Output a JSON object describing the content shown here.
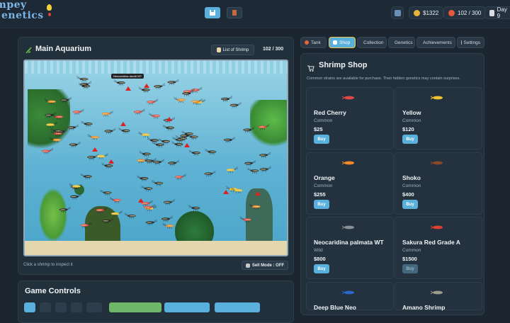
{
  "app": {
    "logo_line1": "mpey",
    "logo_line2": "enetics"
  },
  "stats": {
    "money": "$1322",
    "shrimp_count": "102 / 300",
    "day": "Day 9"
  },
  "aquarium": {
    "title": "Main Aquarium",
    "list_button": "List of Shrimp",
    "count": "102 / 300",
    "hint": "Click a shrimp to inspect it",
    "sell_mode": "Sell Mode : OFF",
    "tooltip": "Neocaridina davidi WT"
  },
  "tabs": [
    {
      "label": "Tank",
      "icon": "fish-icon"
    },
    {
      "label": "Shop",
      "icon": "cart-icon"
    },
    {
      "label": "Collection",
      "icon": "book-icon"
    },
    {
      "label": "Genetics",
      "icon": "dna-icon"
    },
    {
      "label": "Achievements",
      "icon": "trophy-icon"
    },
    {
      "label": "Settings",
      "icon": "gear-icon"
    }
  ],
  "shop": {
    "title": "Shrimp Shop",
    "subtitle": "Common strains are available for purchase. Their hidden genetics may contain surprises.",
    "buy_label": "Buy",
    "items": [
      {
        "name": "Red Cherry",
        "rarity": "Common",
        "price": "$25",
        "color": "#e04848"
      },
      {
        "name": "Yellow",
        "rarity": "Common",
        "price": "$120",
        "color": "#f1c232"
      },
      {
        "name": "Orange",
        "rarity": "Common",
        "price": "$255",
        "color": "#f08a2a"
      },
      {
        "name": "Shoko",
        "rarity": "Common",
        "price": "$400",
        "color": "#8a4a2a"
      },
      {
        "name": "Neocaridina palmata WT",
        "rarity": "Wild",
        "price": "$800",
        "color": "#8b8f93"
      },
      {
        "name": "Sakura Red Grade A",
        "rarity": "Common",
        "price": "$1500",
        "color": "#e0402f"
      },
      {
        "name": "Deep Blue Neo",
        "rarity": "",
        "price": "",
        "color": "#2c68c9"
      },
      {
        "name": "Amano Shrimp",
        "rarity": "",
        "price": "",
        "color": "#9c9c8a"
      }
    ]
  },
  "controls": {
    "title": "Game Controls"
  }
}
